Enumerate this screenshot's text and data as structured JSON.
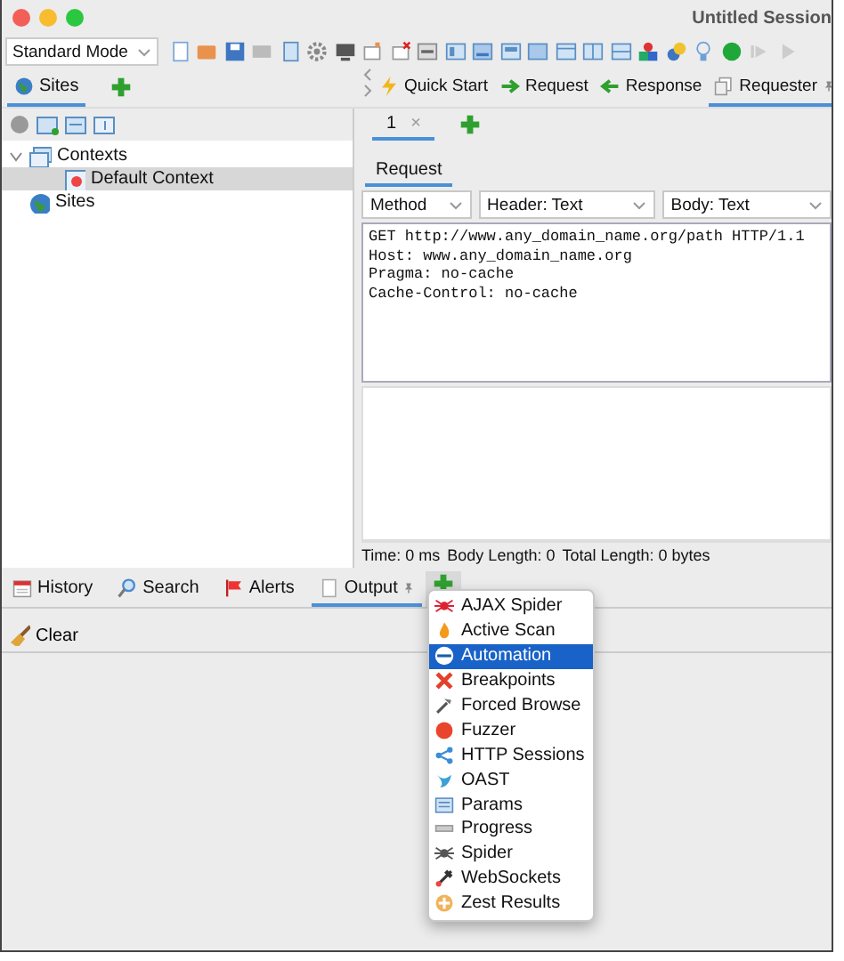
{
  "window": {
    "title": "Untitled Session"
  },
  "toolbar": {
    "mode": "Standard Mode"
  },
  "left_tabs": [
    {
      "label": "Sites",
      "selected": true
    }
  ],
  "sites_tree": [
    {
      "label": "Contexts",
      "expanded": true,
      "selected": false,
      "children": [
        {
          "label": "Default Context",
          "selected": true
        }
      ]
    },
    {
      "label": "Sites",
      "selected": false
    }
  ],
  "main_tabs": [
    {
      "label": "Quick Start",
      "selected": false,
      "pinned": false
    },
    {
      "label": "Request",
      "selected": false,
      "pinned": false
    },
    {
      "label": "Response",
      "selected": false,
      "pinned": false
    },
    {
      "label": "Requester",
      "selected": true,
      "pinned": true
    }
  ],
  "requester_tabs": [
    {
      "label": "1",
      "close": "×",
      "selected": true
    }
  ],
  "request_tabs": [
    {
      "label": "Request",
      "selected": true
    }
  ],
  "dropdowns": [
    "Method",
    "Header: Text",
    "Body: Text"
  ],
  "request_text": [
    "GET http://www.any_domain_name.org/path HTTP/1.1",
    "Host: www.any_domain_name.org",
    "Pragma: no-cache",
    "Cache-Control: no-cache"
  ],
  "status_bar": [
    "Time: 0 ms",
    "Body Length: 0",
    "Total Length: 0 bytes"
  ],
  "bottom_tabs": [
    {
      "label": "History",
      "selected": false,
      "pinned": false
    },
    {
      "label": "Search",
      "selected": false,
      "pinned": false
    },
    {
      "label": "Alerts",
      "selected": false,
      "pinned": false
    },
    {
      "label": "Output",
      "selected": true,
      "pinned": true
    }
  ],
  "output_toolbar": {
    "clear": "Clear"
  },
  "add_menu": [
    {
      "label": "AJAX Spider",
      "selected": false
    },
    {
      "label": "Active Scan",
      "selected": false
    },
    {
      "label": "Automation",
      "selected": true
    },
    {
      "label": "Breakpoints",
      "selected": false
    },
    {
      "label": "Forced Browse",
      "selected": false
    },
    {
      "label": "Fuzzer",
      "selected": false
    },
    {
      "label": "HTTP Sessions",
      "selected": false
    },
    {
      "label": "OAST",
      "selected": false
    },
    {
      "label": "Params",
      "selected": false
    },
    {
      "label": "Progress",
      "selected": false
    },
    {
      "label": "Spider",
      "selected": false
    },
    {
      "label": "WebSockets",
      "selected": false
    },
    {
      "label": "Zest Results",
      "selected": false
    }
  ]
}
